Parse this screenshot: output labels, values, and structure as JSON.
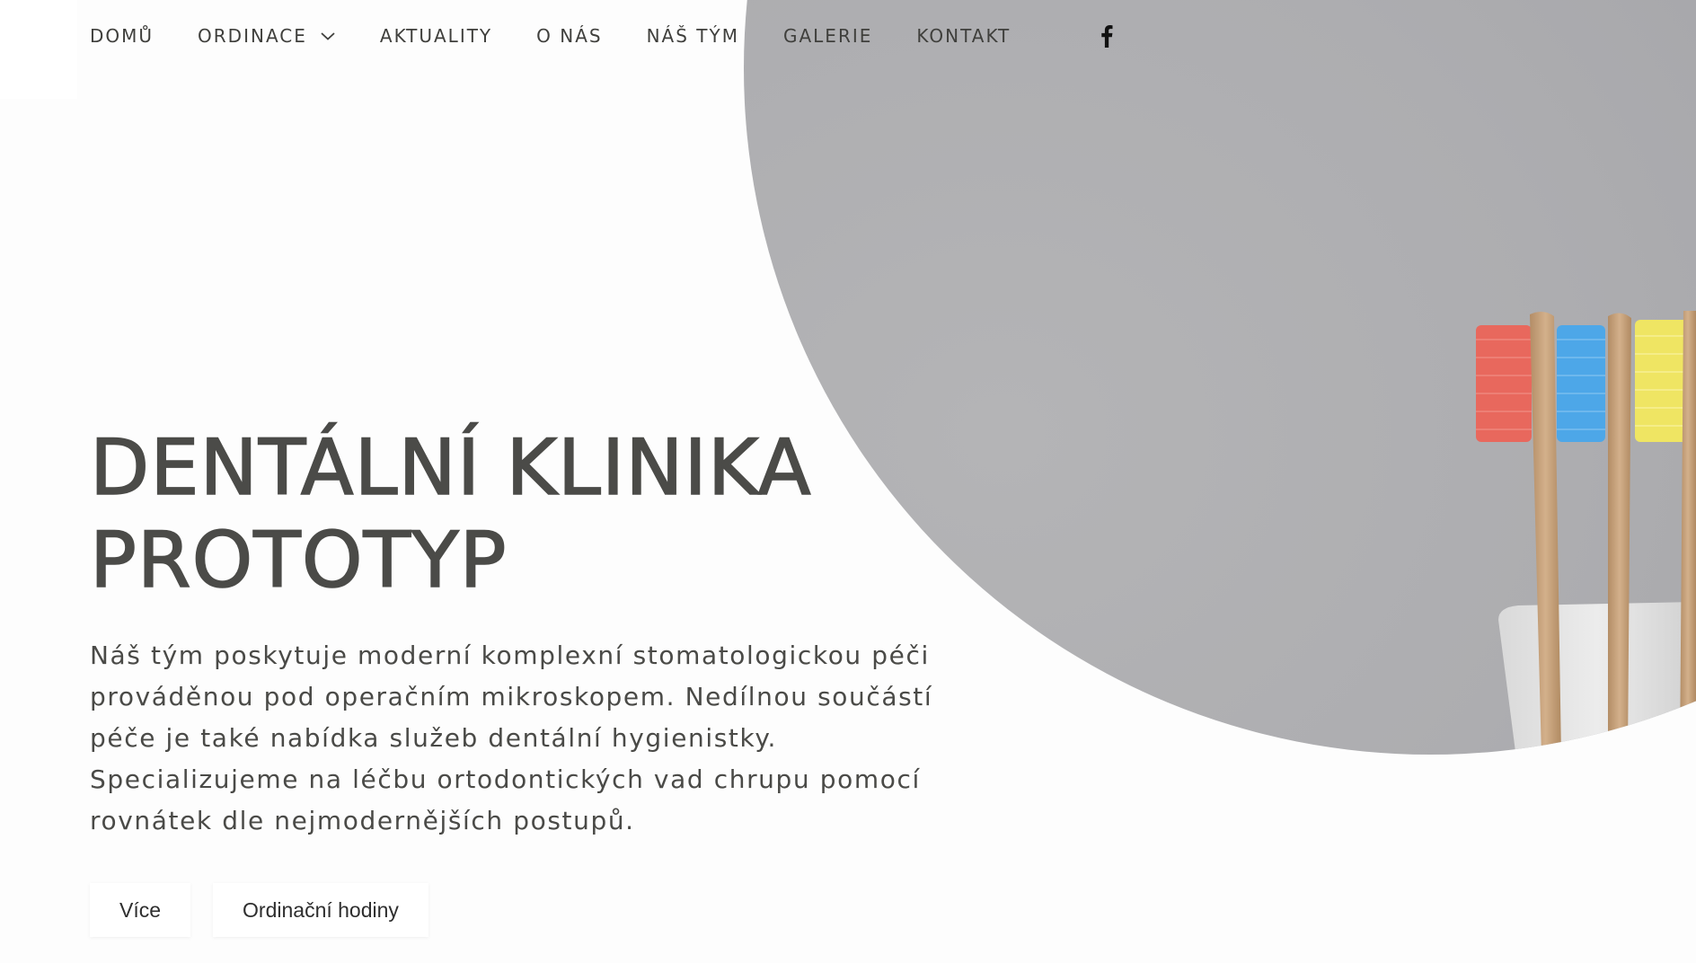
{
  "nav": {
    "items": [
      {
        "label": "DOMŮ"
      },
      {
        "label": "ORDINACE",
        "has_dropdown": true
      },
      {
        "label": "AKTUALITY"
      },
      {
        "label": "O NÁS"
      },
      {
        "label": "NÁŠ TÝM"
      },
      {
        "label": "GALERIE"
      },
      {
        "label": "KONTAKT"
      }
    ],
    "social_icon": "facebook-icon"
  },
  "hero": {
    "title_line1": "DENTÁLNÍ KLINIKA",
    "title_line2": "PROTOTYP",
    "description": "Náš tým poskytuje moderní komplexní stomatologickou péči prováděnou pod operačním mikroskopem. Nedílnou součástí péče je také nabídka služeb dentální hygienistky. Specializujeme na léčbu ortodontických vad chrupu pomocí rovnátek dle nejmodernějších postupů.",
    "buttons": {
      "more": "Více",
      "hours": "Ordinační hodiny"
    }
  },
  "colors": {
    "text": "#4a4a47",
    "background": "#fdfdfd",
    "photo_backdrop": "#b0b0b2",
    "brush_red": "#e8685d",
    "brush_blue": "#4da7e8",
    "brush_yellow": "#efe563",
    "bamboo": "#c9a57f"
  }
}
